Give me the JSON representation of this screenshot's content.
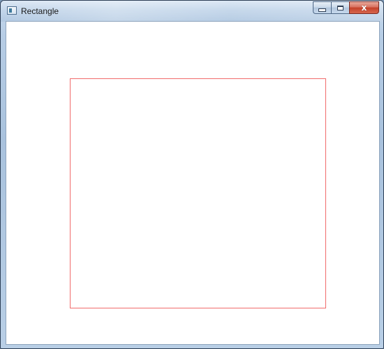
{
  "window": {
    "title": "Rectangle",
    "app_icon": "window-app-icon",
    "caption_buttons": {
      "minimize": "minimize-icon",
      "maximize": "maximize-icon",
      "close": "close-icon",
      "close_glyph": "x"
    }
  },
  "canvas": {
    "background": "#ffffff",
    "shape": {
      "type": "rectangle",
      "stroke_color": "#f16b6b",
      "fill": "none"
    }
  }
}
